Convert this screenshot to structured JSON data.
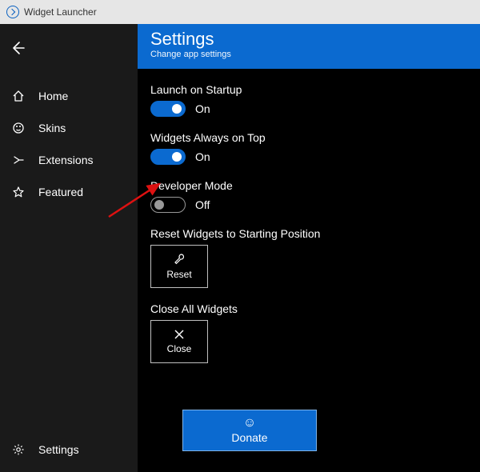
{
  "window": {
    "title": "Widget Launcher"
  },
  "sidebar": {
    "items": [
      {
        "icon": "home-icon",
        "label": "Home"
      },
      {
        "icon": "skins-icon",
        "label": "Skins"
      },
      {
        "icon": "extensions-icon",
        "label": "Extensions"
      },
      {
        "icon": "featured-icon",
        "label": "Featured"
      }
    ],
    "bottom": {
      "icon": "gear-icon",
      "label": "Settings"
    }
  },
  "header": {
    "title": "Settings",
    "subtitle": "Change app settings"
  },
  "settings": {
    "launch_on_startup": {
      "label": "Launch on Startup",
      "state": "On",
      "on": true
    },
    "always_on_top": {
      "label": "Widgets Always on Top",
      "state": "On",
      "on": true
    },
    "developer_mode": {
      "label": "Developer Mode",
      "state": "Off",
      "on": false
    },
    "reset": {
      "label": "Reset Widgets to Starting Position",
      "button": "Reset"
    },
    "close_all": {
      "label": "Close All Widgets",
      "button": "Close"
    }
  },
  "donate": {
    "label": "Donate"
  },
  "colors": {
    "accent": "#0b6ad0",
    "sidebar": "#1a1a1a",
    "titlebar": "#e6e6e6"
  }
}
